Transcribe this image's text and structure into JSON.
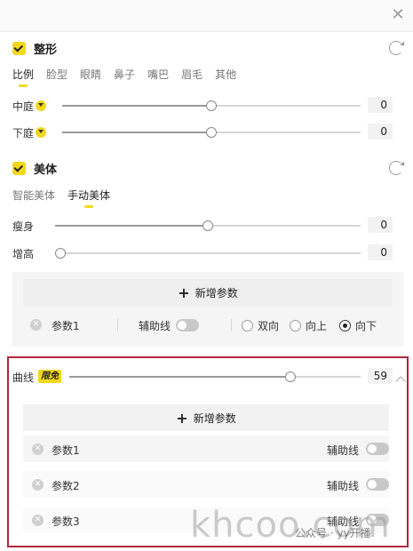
{
  "close_glyph": "✕",
  "shape": {
    "title": "整形",
    "tabs": [
      "比例",
      "脸型",
      "眼睛",
      "鼻子",
      "嘴巴",
      "眉毛",
      "其他"
    ],
    "active_tab": "比例",
    "sliders": [
      {
        "label": "中庭",
        "value": "0",
        "level": 0.5
      },
      {
        "label": "下庭",
        "value": "0",
        "level": 0.5
      }
    ]
  },
  "body": {
    "title": "美体",
    "tabs": [
      "智能美体",
      "手动美体"
    ],
    "active_tab": "手动美体",
    "sliders": [
      {
        "label": "瘦身",
        "value": "0",
        "level": 0.5
      },
      {
        "label": "增高",
        "value": "0",
        "level": 0.0
      }
    ],
    "add_param": "新增参数",
    "param": {
      "label": "参数1",
      "guide_label": "辅助线",
      "guide_on": false,
      "directions": [
        "双向",
        "向上",
        "向下"
      ],
      "selected_direction": "向下"
    }
  },
  "curve": {
    "label": "曲线",
    "badge": "限免",
    "value": "59",
    "level": 0.76,
    "add_param": "新增参数",
    "params": [
      {
        "label": "参数1",
        "guide_label": "辅助线",
        "guide_on": false
      },
      {
        "label": "参数2",
        "guide_label": "辅助线",
        "guide_on": false
      },
      {
        "label": "参数3",
        "guide_label": "辅助线",
        "guide_on": false
      }
    ]
  },
  "watermark": {
    "text": "khcoo.com",
    "source": "公众号 · yy开播"
  },
  "colors": {
    "accent": "#f2d81b",
    "highlight_border": "#b3263b"
  }
}
